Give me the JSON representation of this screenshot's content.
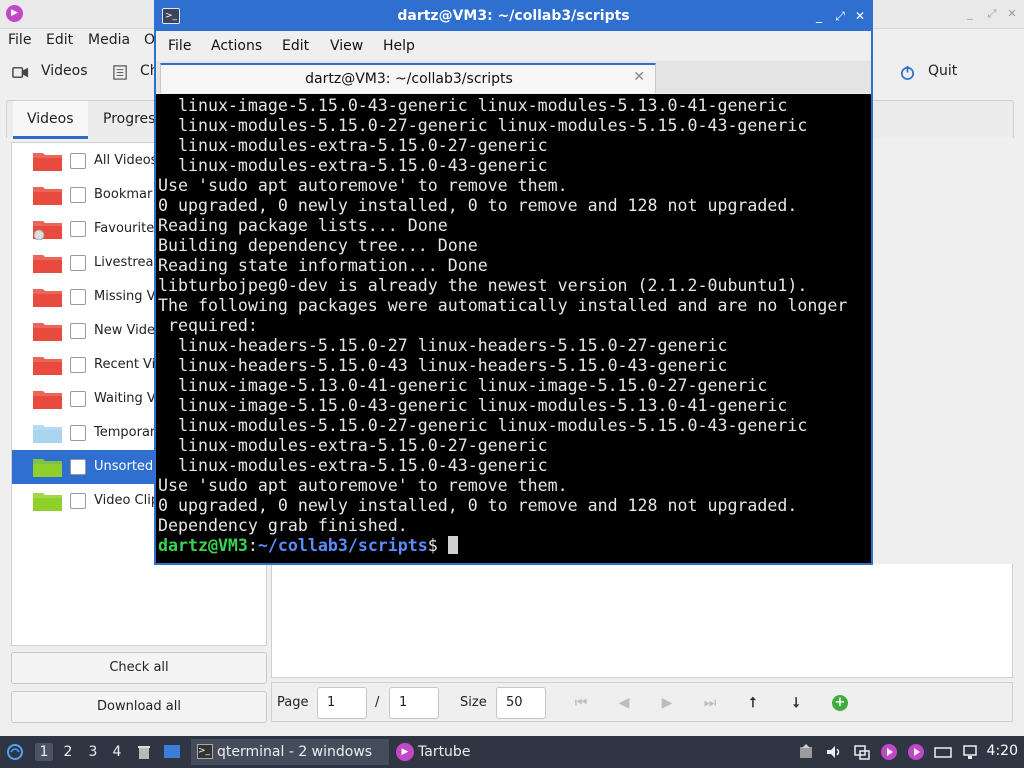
{
  "background_app": {
    "menu": [
      "File",
      "Edit",
      "Media",
      "O"
    ],
    "toolbar": {
      "videos_label": "Videos",
      "check_label": "Ch",
      "quit_label": "Quit"
    },
    "tabs": [
      "Videos",
      "Progress"
    ],
    "folders": [
      {
        "label": "All Videos",
        "color": "#e84a3d",
        "emblem": ""
      },
      {
        "label": "Bookmar",
        "color": "#e84a3d",
        "emblem": ""
      },
      {
        "label": "Favourite",
        "color": "#e84a3d",
        "emblem": "heart"
      },
      {
        "label": "Livestrea",
        "color": "#e84a3d",
        "emblem": ""
      },
      {
        "label": "Missing V",
        "color": "#e84a3d",
        "emblem": ""
      },
      {
        "label": "New Vide",
        "color": "#e84a3d",
        "emblem": ""
      },
      {
        "label": "Recent Vi",
        "color": "#e84a3d",
        "emblem": ""
      },
      {
        "label": "Waiting V",
        "color": "#e84a3d",
        "emblem": ""
      },
      {
        "label": "Temporar",
        "color": "#a8d4ef",
        "emblem": ""
      },
      {
        "label": "Unsorted",
        "color": "#8fd12a",
        "emblem": "",
        "selected": true
      },
      {
        "label": "Video Clip",
        "color": "#8fd12a",
        "emblem": ""
      }
    ],
    "check_all_label": "Check all",
    "download_all_label": "Download all",
    "pager": {
      "page_label": "Page",
      "page_value": "1",
      "separator": "/",
      "page_total": "1",
      "size_label": "Size",
      "size_value": "50"
    }
  },
  "terminal": {
    "window_title": "dartz@VM3: ~/collab3/scripts",
    "menu": [
      "File",
      "Actions",
      "Edit",
      "View",
      "Help"
    ],
    "tab_title": "dartz@VM3: ~/collab3/scripts",
    "lines": [
      "  linux-image-5.15.0-43-generic linux-modules-5.13.0-41-generic",
      "  linux-modules-5.15.0-27-generic linux-modules-5.15.0-43-generic",
      "  linux-modules-extra-5.15.0-27-generic",
      "  linux-modules-extra-5.15.0-43-generic",
      "Use 'sudo apt autoremove' to remove them.",
      "0 upgraded, 0 newly installed, 0 to remove and 128 not upgraded.",
      "Reading package lists... Done",
      "Building dependency tree... Done",
      "Reading state information... Done",
      "libturbojpeg0-dev is already the newest version (2.1.2-0ubuntu1).",
      "The following packages were automatically installed and are no longer",
      " required:",
      "  linux-headers-5.15.0-27 linux-headers-5.15.0-27-generic",
      "  linux-headers-5.15.0-43 linux-headers-5.15.0-43-generic",
      "  linux-image-5.13.0-41-generic linux-image-5.15.0-27-generic",
      "  linux-image-5.15.0-43-generic linux-modules-5.13.0-41-generic",
      "  linux-modules-5.15.0-27-generic linux-modules-5.15.0-43-generic",
      "  linux-modules-extra-5.15.0-27-generic",
      "  linux-modules-extra-5.15.0-43-generic",
      "Use 'sudo apt autoremove' to remove them.",
      "0 upgraded, 0 newly installed, 0 to remove and 128 not upgraded.",
      "Dependency grab finished."
    ],
    "prompt": {
      "user_host": "dartz@VM3",
      "colon": ":",
      "path": "~/collab3/scripts",
      "symbol": "$ "
    }
  },
  "taskbar": {
    "workspaces": [
      "1",
      "2",
      "3",
      "4"
    ],
    "tasks": [
      {
        "label": "qterminal - 2 windows",
        "icon": "terminal-icon"
      },
      {
        "label": "Tartube",
        "icon": "tartube-icon"
      }
    ],
    "clock": "4:20"
  }
}
